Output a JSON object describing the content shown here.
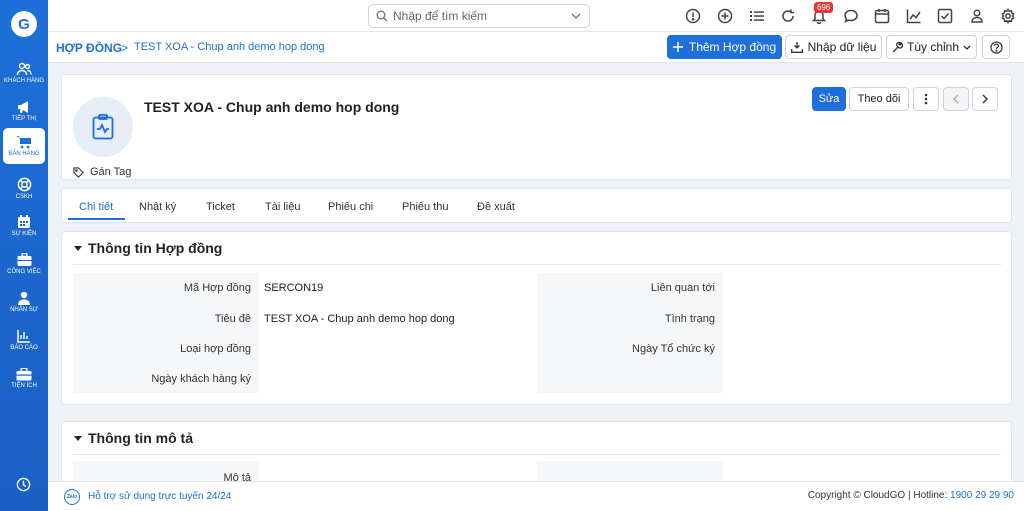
{
  "app": {
    "logo_letter": "G"
  },
  "sidebar": {
    "items": [
      {
        "label": "KHÁCH HÀNG",
        "icon": "users-icon"
      },
      {
        "label": "TIẾP THỊ",
        "icon": "megaphone-icon"
      },
      {
        "label": "BÁN HÀNG",
        "icon": "cart-icon",
        "active": true
      },
      {
        "label": "CSKH",
        "icon": "lifebuoy-icon"
      },
      {
        "label": "SỰ KIỆN",
        "icon": "calendar-icon"
      },
      {
        "label": "CÔNG VIỆC",
        "icon": "briefcase-icon"
      },
      {
        "label": "NHÂN SỰ",
        "icon": "person-icon"
      },
      {
        "label": "BÁO CÁO",
        "icon": "report-icon"
      },
      {
        "label": "TIỆN ÍCH",
        "icon": "toolbox-icon"
      }
    ]
  },
  "topbar": {
    "search_placeholder": "Nhập để tìm kiếm",
    "notification_count": "696"
  },
  "breadcrumb": {
    "root": "HỢP ĐỒNG",
    "separator": ">",
    "current": "TEST XOA - Chup anh demo hop dong"
  },
  "actions": {
    "add_label": "Thêm Hợp đồng",
    "import_label": "Nhập dữ liệu",
    "customize_label": "Tùy chỉnh"
  },
  "record": {
    "title": "TEST XOA - Chup anh demo hop dong",
    "tag_label": "Gán Tag",
    "edit_label": "Sửa",
    "follow_label": "Theo dõi"
  },
  "tabs": [
    "Chi tiết",
    "Nhật ký",
    "Ticket",
    "Tài liệu",
    "Phiếu chi",
    "Phiếu thu",
    "Đề xuất"
  ],
  "section_contract": {
    "title": "Thông tin Hợp đồng",
    "left_fields": [
      {
        "label": "Mã Hợp đồng",
        "value": "SERCON19"
      },
      {
        "label": "Tiêu đề",
        "value": "TEST XOA - Chup anh demo hop dong"
      },
      {
        "label": "Loại hợp đồng",
        "value": ""
      },
      {
        "label": "Ngày khách hàng ký",
        "value": ""
      }
    ],
    "right_fields": [
      {
        "label": "Liên quan tới",
        "value": ""
      },
      {
        "label": "Tình trạng",
        "value": ""
      },
      {
        "label": "Ngày Tổ chức ký",
        "value": ""
      }
    ]
  },
  "section_description": {
    "title": "Thông tin mô tả",
    "fields": [
      {
        "label": "Mô tả",
        "value": ""
      }
    ]
  },
  "footer": {
    "support": "Hỗ trợ sử dụng trực tuyến 24/24",
    "zalo_label": "Zalo",
    "copyright": "Copyright © CloudGO",
    "hotline_label": "| Hotline:",
    "hotline": "1900 29 29 90"
  },
  "colors": {
    "brand": "#1e6fd9",
    "badge": "#e53935"
  }
}
